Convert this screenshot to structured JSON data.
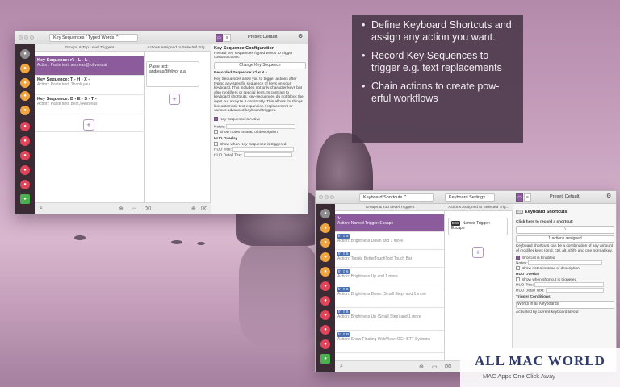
{
  "info": {
    "bullets": [
      "Define Keyboard Shortcuts and assign any action you want.",
      "Record Key Sequences to trigger e.g. text replacements",
      "Chain actions to create pow-erful workflows"
    ]
  },
  "win1": {
    "preset_dropdown": "Key Sequences / Typed Words",
    "preset_label": "Preset: Default",
    "col_left": "Groups & Top Level Triggers",
    "col_mid": "Actions Assigned to Selected Trig...",
    "triggers": [
      {
        "title": "Key Sequence: r'\\ - L - L -",
        "action": "Action: Paste text: andreas@folivora.ai"
      },
      {
        "title": "Key Sequence: T - H - X -",
        "action": "Action: Paste text: Thank you!"
      },
      {
        "title": "Key Sequence: B - E - S - T -",
        "action": "Action: Paste text: Best,#Andreas"
      }
    ],
    "action_card": "Paste text: andreas@folivor a.ai",
    "config": {
      "title": "Key Sequence Configuration",
      "subtitle": "Record key sequences /typed words to trigger customactions.",
      "change_btn": "Change Key Sequence",
      "recorded": "Recorded Sequence: r'\\ •L•L•",
      "desc": "Key Sequences allow you to trigger actions after typing any specific sequence of keys on your keyboard. This includes not only character keys but also modifiers or special keys. In contrast to keyboard shortcuts, key-sequences do not block the input but analyze it constantly. This allows for things like automatic text expansion / replacement or various advanced keyboard triggers.",
      "active": "Key Sequence is Active",
      "notes": "Notes:",
      "show_notes": "Show notes instead of description",
      "hud": "HUD Overlay",
      "hud_show": "Show when Key Sequence is triggered",
      "hud_title": "HUD Title:",
      "hud_detail": "HUD Detail Text:"
    }
  },
  "win2": {
    "preset_dropdown": "Keyboard Shortcuts",
    "settings_btn": "Keyboard Settings",
    "preset_label": "Preset: Default",
    "col_left": "Groups & Top Level Triggers",
    "col_mid": "Actions Assigned to Selected Trig...",
    "triggers": [
      {
        "keys": "",
        "title": "Action: Named Trigger: Escape",
        "action": ""
      },
      {
        "keys": "fn ⇧ 5",
        "title": "",
        "action": "Action: Brightness Down and 1 more"
      },
      {
        "keys": "fn ⇧ 5",
        "title": "",
        "action": "Action: Toggle BetterTouchTool Touch Bar"
      },
      {
        "keys": "fn ⇧ 6",
        "title": "",
        "action": "Action: Brightness Up and 1 more"
      },
      {
        "keys": "fn ⇧ 5",
        "title": "",
        "action": "Action: Brightness Down (Small Step) and 1 more"
      },
      {
        "keys": "fn ⇧ 6",
        "title": "",
        "action": "Action: Brightness Up (Small Step) and 1 more"
      },
      {
        "keys": "fn ⇧ P",
        "title": "",
        "action": "Action: Show Floating WebView: OC> BTT Systems"
      }
    ],
    "action_card": "Named Trigger: Escape",
    "action_badge": "ESC",
    "config": {
      "title": "Keyboard Shortcuts",
      "record_hint": "Click here to record a shortcut:",
      "shortcut_value": "\\",
      "assigned": "1 actions assigned",
      "desc": "Keyboard shortcuts can be a combination of any amount of modifier keys (cmd, ctrl, alt, shift) and one normal key.",
      "enabled": "Shortcut is Enabled",
      "notes": "Notes:",
      "show_notes": "Show notes instead of description",
      "hud": "HUD Overlay",
      "hud_show": "Show when shortcut is triggered",
      "hud_title": "HUD Title:",
      "hud_detail": "HUD Detail Text:",
      "conditions": "Trigger Conditions:",
      "cond_value": "Works in all Keyboards",
      "cond_hint": "Activated by current keyboard layout"
    }
  },
  "watermark": {
    "title": "ALL MAC WORLD",
    "tagline": "MAC Apps One Click Away"
  }
}
